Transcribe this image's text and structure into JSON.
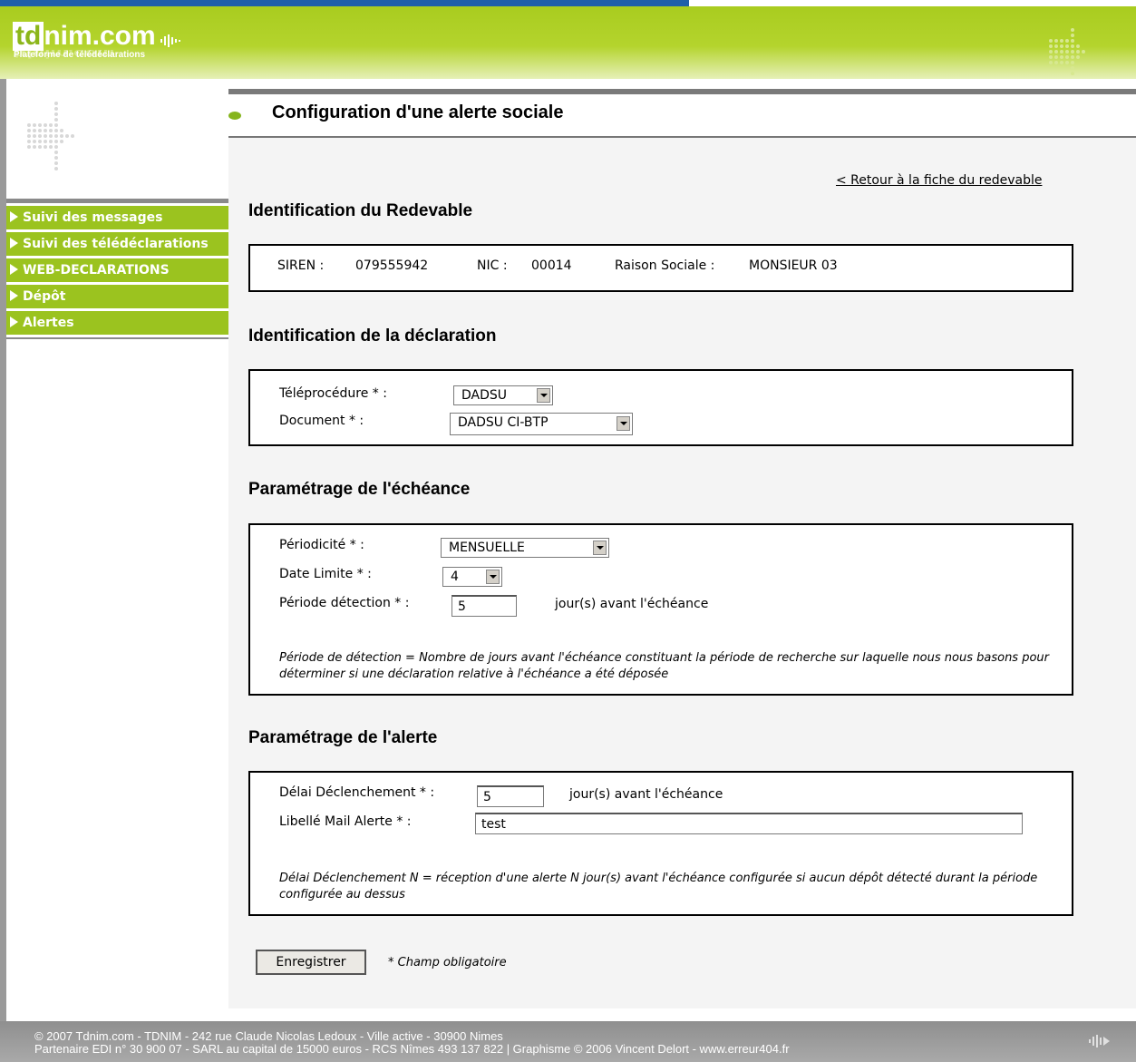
{
  "header": {
    "logo_td": "td",
    "logo_rest": "nim.com",
    "logo_sub": "Plateforme de télédéclarations",
    "logo_reflection": "tdnim.com"
  },
  "nav": {
    "items": [
      {
        "label": "Suivi des messages"
      },
      {
        "label": "Suivi des télédéclarations"
      },
      {
        "label": "WEB-DECLARATIONS"
      },
      {
        "label": "Dépôt"
      },
      {
        "label": "Alertes"
      }
    ]
  },
  "page": {
    "title": "Configuration d'une alerte sociale",
    "back_link": "< Retour à la fiche du redevable"
  },
  "redevable": {
    "heading": "Identification du Redevable",
    "siren_label": "SIREN :",
    "siren": "079555942",
    "nic_label": "NIC :",
    "nic": "00014",
    "raison_label": "Raison Sociale :",
    "raison": "MONSIEUR 03"
  },
  "declaration": {
    "heading": "Identification de la déclaration",
    "teleprocedure_label": "Téléprocédure",
    "teleprocedure_value": "DADSU",
    "document_label": "Document",
    "document_value": "DADSU CI-BTP"
  },
  "echeance": {
    "heading": "Paramétrage de l'échéance",
    "periodicite_label": "Périodicité",
    "periodicite_value": "MENSUELLE",
    "date_limite_label": "Date Limite",
    "date_limite_value": "4",
    "periode_label": "Période détection",
    "periode_value": "5",
    "periode_suffix": "jour(s) avant l'échéance",
    "note": "Période de détection = Nombre de jours avant l'échéance constituant la période de recherche sur laquelle nous nous basons pour déterminer si une déclaration relative à l'échéance a été déposée"
  },
  "alerte": {
    "heading": "Paramétrage de l'alerte",
    "delai_label": "Délai Déclenchement",
    "delai_value": "5",
    "delai_suffix": "jour(s) avant l'échéance",
    "libelle_label": "Libellé Mail Alerte",
    "libelle_value": "test",
    "note": "Délai Déclenchement N = réception d'une alerte N jour(s) avant l'échéance configurée si aucun dépôt détecté durant la période configurée au dessus"
  },
  "form": {
    "required_mark": "* :",
    "save_label": "Enregistrer",
    "required_note": "* Champ obligatoire"
  },
  "footer": {
    "line1": "© 2007 Tdnim.com - TDNIM - 242 rue Claude Nicolas Ledoux - Ville active - 30900 Nimes",
    "line2": "Partenaire EDI n° 30 900 07 - SARL au capital de 15000 euros - RCS Nîmes 493 137 822 | Graphisme © 2006 Vincent Delort - www.erreur404.fr"
  },
  "colors": {
    "brand_green": "#9bc31f",
    "link_blue": "#1f5fa8",
    "footer_gray": "#9c9c9c"
  }
}
